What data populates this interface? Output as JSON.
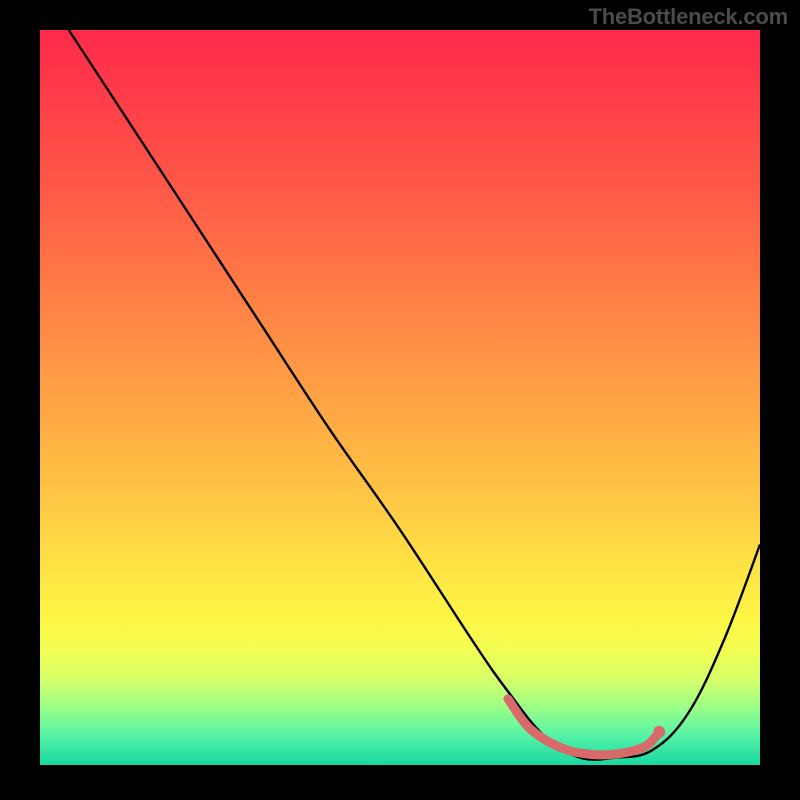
{
  "watermark": "TheBottleneck.com",
  "chart_data": {
    "type": "line",
    "title": "",
    "xlabel": "",
    "ylabel": "",
    "xlim": [
      0,
      100
    ],
    "ylim": [
      0,
      100
    ],
    "grid": false,
    "legend": false,
    "series": [
      {
        "name": "bottleneck-curve",
        "x": [
          4,
          10,
          20,
          30,
          40,
          50,
          60,
          65,
          70,
          75,
          80,
          85,
          90,
          95,
          100
        ],
        "y": [
          100,
          91,
          76,
          61,
          46,
          32,
          17,
          10,
          4,
          1,
          1,
          2,
          7,
          17,
          30
        ],
        "color": "#000000"
      },
      {
        "name": "optimum-segment",
        "x": [
          65,
          68,
          72,
          76,
          80,
          84,
          86
        ],
        "y": [
          9,
          5,
          2.5,
          1.5,
          1.5,
          2.5,
          4.5
        ],
        "color": "#d86a6a"
      }
    ],
    "optimum_point": {
      "x": 86,
      "y": 4.5,
      "color": "#d86a6a"
    },
    "gradient_stops": [
      {
        "pct": 0,
        "color": "#ff2a49"
      },
      {
        "pct": 50,
        "color": "#ffa245"
      },
      {
        "pct": 80,
        "color": "#fdf544"
      },
      {
        "pct": 100,
        "color": "#17d8a0"
      }
    ]
  }
}
